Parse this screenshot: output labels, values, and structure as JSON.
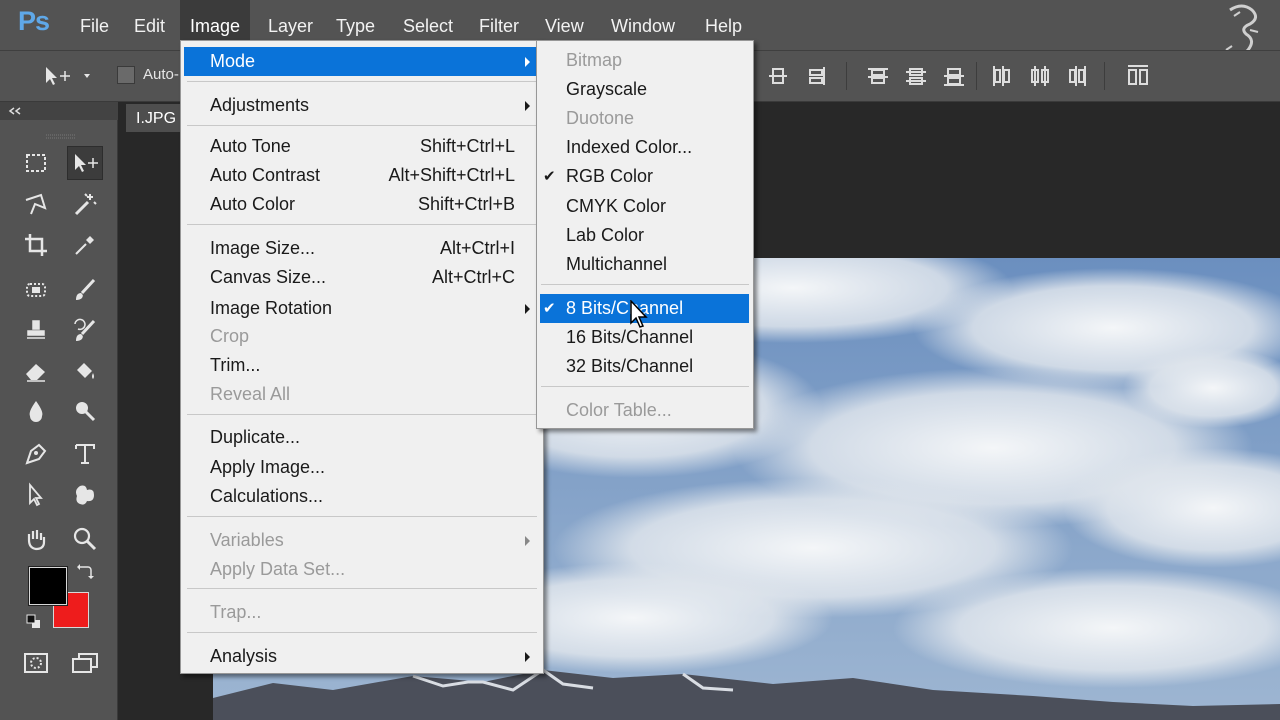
{
  "app": {
    "logo": "Ps"
  },
  "menubar": {
    "items": [
      "File",
      "Edit",
      "Image",
      "Layer",
      "Type",
      "Select",
      "Filter",
      "View",
      "Window",
      "Help"
    ],
    "active": "Image"
  },
  "options": {
    "auto_select_label": "Auto-"
  },
  "document": {
    "tab_title": "I.JPG"
  },
  "image_menu": {
    "mode": "Mode",
    "adjustments": "Adjustments",
    "auto_tone": {
      "label": "Auto Tone",
      "shortcut": "Shift+Ctrl+L"
    },
    "auto_contrast": {
      "label": "Auto Contrast",
      "shortcut": "Alt+Shift+Ctrl+L"
    },
    "auto_color": {
      "label": "Auto Color",
      "shortcut": "Shift+Ctrl+B"
    },
    "image_size": {
      "label": "Image Size...",
      "shortcut": "Alt+Ctrl+I"
    },
    "canvas_size": {
      "label": "Canvas Size...",
      "shortcut": "Alt+Ctrl+C"
    },
    "image_rotation": "Image Rotation",
    "crop": "Crop",
    "trim": "Trim...",
    "reveal_all": "Reveal All",
    "duplicate": "Duplicate...",
    "apply_image": "Apply Image...",
    "calculations": "Calculations...",
    "variables": "Variables",
    "apply_data_set": "Apply Data Set...",
    "trap": "Trap...",
    "analysis": "Analysis"
  },
  "mode_submenu": {
    "bitmap": "Bitmap",
    "grayscale": "Grayscale",
    "duotone": "Duotone",
    "indexed_color": "Indexed Color...",
    "rgb_color": "RGB Color",
    "cmyk_color": "CMYK Color",
    "lab_color": "Lab Color",
    "multichannel": "Multichannel",
    "bits8": "8 Bits/Channel",
    "bits16": "16 Bits/Channel",
    "bits32": "32 Bits/Channel",
    "color_table": "Color Table...",
    "check": "✔"
  },
  "colors": {
    "foreground": "#000000",
    "background": "#ee1c1c",
    "highlight": "#0a73d9"
  }
}
